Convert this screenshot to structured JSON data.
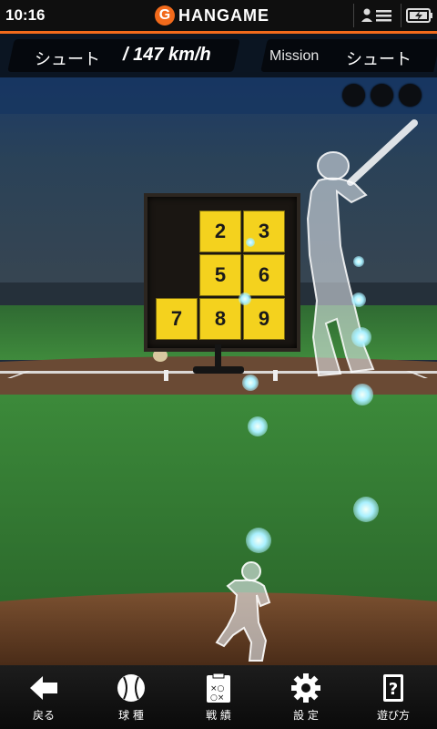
{
  "status_bar": {
    "time": "10:16",
    "brand_letter": "G",
    "brand_name": "HANGAME",
    "brand_color": "#f26a1b"
  },
  "info_bar": {
    "pitch_type": "シュート",
    "speed": "/ 147 km/h",
    "mission_label": "Mission",
    "mission_value": "シュート"
  },
  "strike_zone": {
    "cells": [
      {
        "label": "",
        "lit": false
      },
      {
        "label": "2",
        "lit": true
      },
      {
        "label": "3",
        "lit": true
      },
      {
        "label": "",
        "lit": false
      },
      {
        "label": "5",
        "lit": true
      },
      {
        "label": "6",
        "lit": true
      },
      {
        "label": "7",
        "lit": true
      },
      {
        "label": "8",
        "lit": true
      },
      {
        "label": "9",
        "lit": true
      }
    ],
    "cell_color": "#f4d21e"
  },
  "mission_progress": {
    "total": 3,
    "filled": 0
  },
  "nav": {
    "items": [
      {
        "label": "戻る",
        "icon": "back-arrow-icon"
      },
      {
        "label": "球 種",
        "icon": "baseball-icon"
      },
      {
        "label": "戦 績",
        "icon": "clipboard-icon"
      },
      {
        "label": "設 定",
        "icon": "gear-icon"
      },
      {
        "label": "遊び方",
        "icon": "help-icon"
      }
    ]
  }
}
